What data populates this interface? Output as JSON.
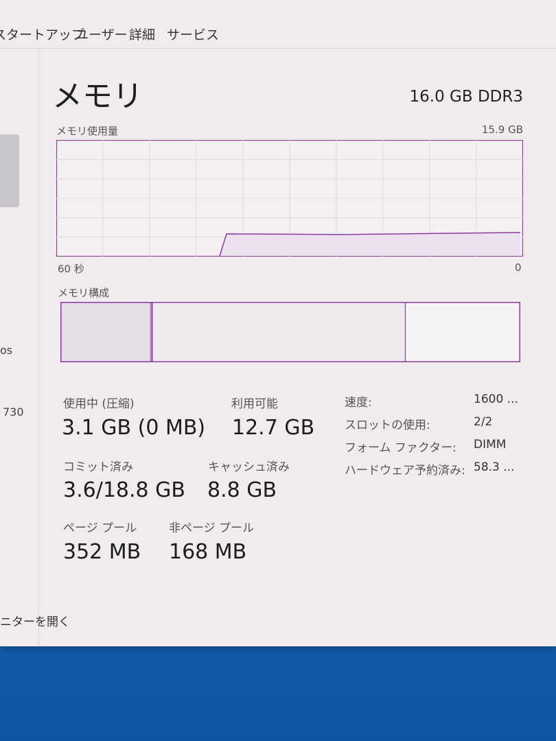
{
  "tabs": [
    "スタートアップ",
    "ユーザー",
    "詳細",
    "サービス"
  ],
  "left_pane": {
    "item_fragment_1": "os",
    "item_fragment_2": "730"
  },
  "memory": {
    "title": "メモリ",
    "spec": "16.0 GB DDR3",
    "usage_label": "メモリ使用量",
    "usage_max": "15.9 GB",
    "time_left": "60 秒",
    "time_right": "0",
    "composition_label": "メモリ構成",
    "usage_history_fraction": {
      "before_start": 0.0,
      "used": 0.195
    },
    "composition": {
      "in_use": 0.195,
      "modified": 0.005,
      "standby": 0.55,
      "free": 0.25
    }
  },
  "stats": {
    "in_use_label": "使用中 (圧縮)",
    "in_use_value": "3.1 GB (0 MB)",
    "available_label": "利用可能",
    "available_value": "12.7 GB",
    "committed_label": "コミット済み",
    "committed_value": "3.6/18.8 GB",
    "cached_label": "キャッシュ済み",
    "cached_value": "8.8 GB",
    "paged_label": "ページ プール",
    "paged_value": "352 MB",
    "nonpaged_label": "非ページ プール",
    "nonpaged_value": "168 MB"
  },
  "props": [
    {
      "label": "速度:",
      "value": "1600 ..."
    },
    {
      "label": "スロットの使用:",
      "value": "2/2"
    },
    {
      "label": "フォーム ファクター:",
      "value": "DIMM"
    },
    {
      "label": "ハードウェア予約済み:",
      "value": "58.3 ..."
    }
  ],
  "footer_link": "ニターを開く",
  "colors": {
    "accent": "#8b3a9e",
    "grid": "#e3d7e6",
    "window_bg": "#f1ecec",
    "desktop": "#1d74c2"
  }
}
